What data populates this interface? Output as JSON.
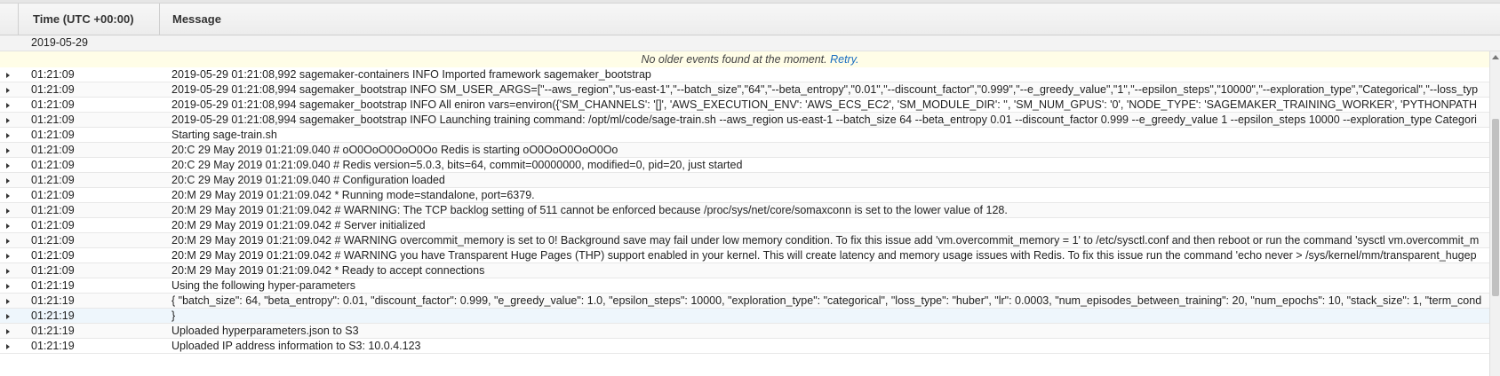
{
  "header": {
    "time_col": "Time (UTC +00:00)",
    "message_col": "Message"
  },
  "date_group": "2019-05-29",
  "notice": {
    "text": "No older events found at the moment.",
    "link": "Retry."
  },
  "rows": [
    {
      "time": "01:21:09",
      "message": "2019-05-29 01:21:08,992 sagemaker-containers INFO Imported framework sagemaker_bootstrap"
    },
    {
      "time": "01:21:09",
      "message": "2019-05-29 01:21:08,994 sagemaker_bootstrap INFO SM_USER_ARGS=[\"--aws_region\",\"us-east-1\",\"--batch_size\",\"64\",\"--beta_entropy\",\"0.01\",\"--discount_factor\",\"0.999\",\"--e_greedy_value\",\"1\",\"--epsilon_steps\",\"10000\",\"--exploration_type\",\"Categorical\",\"--loss_typ"
    },
    {
      "time": "01:21:09",
      "message": "2019-05-29 01:21:08,994 sagemaker_bootstrap INFO All eniron vars=environ({'SM_CHANNELS': '[]', 'AWS_EXECUTION_ENV': 'AWS_ECS_EC2', 'SM_MODULE_DIR': '', 'SM_NUM_GPUS': '0', 'NODE_TYPE': 'SAGEMAKER_TRAINING_WORKER', 'PYTHONPATH"
    },
    {
      "time": "01:21:09",
      "message": "2019-05-29 01:21:08,994 sagemaker_bootstrap INFO Launching training command: /opt/ml/code/sage-train.sh --aws_region us-east-1 --batch_size 64 --beta_entropy 0.01 --discount_factor 0.999 --e_greedy_value 1 --epsilon_steps 10000 --exploration_type Categori"
    },
    {
      "time": "01:21:09",
      "message": "Starting sage-train.sh"
    },
    {
      "time": "01:21:09",
      "message": "20:C 29 May 2019 01:21:09.040 # oO0OoO0OoO0Oo Redis is starting oO0OoO0OoO0Oo"
    },
    {
      "time": "01:21:09",
      "message": "20:C 29 May 2019 01:21:09.040 # Redis version=5.0.3, bits=64, commit=00000000, modified=0, pid=20, just started"
    },
    {
      "time": "01:21:09",
      "message": "20:C 29 May 2019 01:21:09.040 # Configuration loaded"
    },
    {
      "time": "01:21:09",
      "message": "20:M 29 May 2019 01:21:09.042 * Running mode=standalone, port=6379."
    },
    {
      "time": "01:21:09",
      "message": "20:M 29 May 2019 01:21:09.042 # WARNING: The TCP backlog setting of 511 cannot be enforced because /proc/sys/net/core/somaxconn is set to the lower value of 128."
    },
    {
      "time": "01:21:09",
      "message": "20:M 29 May 2019 01:21:09.042 # Server initialized"
    },
    {
      "time": "01:21:09",
      "message": "20:M 29 May 2019 01:21:09.042 # WARNING overcommit_memory is set to 0! Background save may fail under low memory condition. To fix this issue add 'vm.overcommit_memory = 1' to /etc/sysctl.conf and then reboot or run the command 'sysctl vm.overcommit_m"
    },
    {
      "time": "01:21:09",
      "message": "20:M 29 May 2019 01:21:09.042 # WARNING you have Transparent Huge Pages (THP) support enabled in your kernel. This will create latency and memory usage issues with Redis. To fix this issue run the command 'echo never > /sys/kernel/mm/transparent_hugep"
    },
    {
      "time": "01:21:09",
      "message": "20:M 29 May 2019 01:21:09.042 * Ready to accept connections"
    },
    {
      "time": "01:21:19",
      "message": "Using the following hyper-parameters"
    },
    {
      "time": "01:21:19",
      "message": "{ \"batch_size\": 64, \"beta_entropy\": 0.01, \"discount_factor\": 0.999, \"e_greedy_value\": 1.0, \"epsilon_steps\": 10000, \"exploration_type\": \"categorical\", \"loss_type\": \"huber\", \"lr\": 0.0003, \"num_episodes_between_training\": 20, \"num_epochs\": 10, \"stack_size\": 1, \"term_cond"
    },
    {
      "time": "01:21:19",
      "message": "}"
    },
    {
      "time": "01:21:19",
      "message": "Uploaded hyperparameters.json to S3"
    },
    {
      "time": "01:21:19",
      "message": "Uploaded IP address information to S3: 10.0.4.123"
    }
  ]
}
